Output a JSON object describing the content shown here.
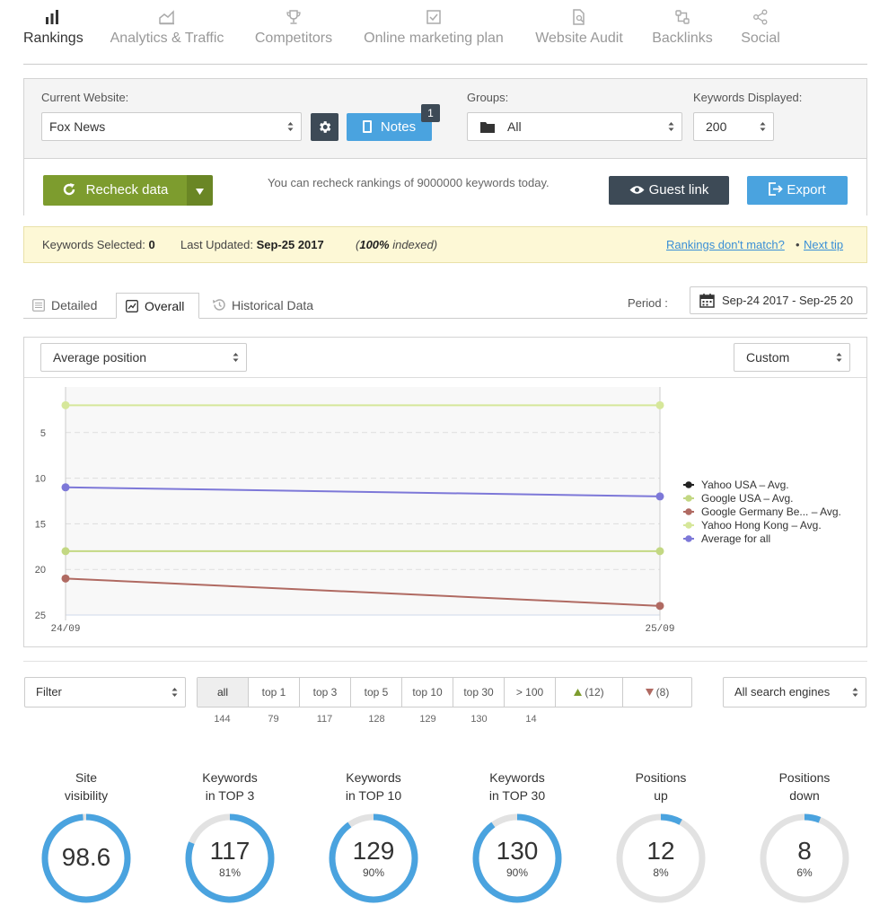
{
  "nav": [
    {
      "label": "Rankings",
      "icon": "bar-chart-icon",
      "active": true
    },
    {
      "label": "Analytics & Traffic",
      "icon": "area-chart-icon"
    },
    {
      "label": "Competitors",
      "icon": "trophy-icon"
    },
    {
      "label": "Online marketing plan",
      "icon": "checkbox-icon"
    },
    {
      "label": "Website Audit",
      "icon": "document-search-icon"
    },
    {
      "label": "Backlinks",
      "icon": "backlinks-icon"
    },
    {
      "label": "Social",
      "icon": "share-icon"
    }
  ],
  "settings": {
    "website_label": "Current Website:",
    "website_value": "Fox News",
    "notes_label": "Notes",
    "notes_badge": "1",
    "groups_label": "Groups:",
    "groups_value": "All",
    "keywords_label": "Keywords Displayed:",
    "keywords_value": "200",
    "recheck_label": "Recheck data",
    "recheck_info": "You can recheck rankings of 9000000 keywords today.",
    "guest_label": "Guest link",
    "export_label": "Export"
  },
  "tipbar": {
    "selected_label": "Keywords Selected:",
    "selected_value": "0",
    "updated_label": "Last Updated:",
    "updated_value": "Sep-25 2017",
    "indexed_pct": "100%",
    "indexed_text": " indexed)",
    "mismatch_link": "Rankings don't match?",
    "sep": "•",
    "next_tip": "Next tip"
  },
  "tabs": {
    "detailed": "Detailed",
    "overall": "Overall",
    "historical": "Historical Data",
    "period_label": "Period :",
    "period_value": "Sep-24 2017 - Sep-25 20"
  },
  "chart_controls": {
    "metric": "Average position",
    "range": "Custom"
  },
  "chart_data": {
    "type": "line",
    "x": [
      "24/09",
      "25/09"
    ],
    "y_reversed": true,
    "ylim": [
      0,
      25
    ],
    "yticks": [
      5,
      10,
      15,
      20,
      25
    ],
    "grid": true,
    "legend_position": "right",
    "series": [
      {
        "name": "Yahoo USA – Avg.",
        "color": "#222222",
        "values": [
          null,
          null
        ]
      },
      {
        "name": "Google USA – Avg.",
        "color": "#c3d883",
        "values": [
          18,
          18
        ]
      },
      {
        "name": "Google Germany Be... – Avg.",
        "color": "#b06a62",
        "values": [
          21,
          24
        ]
      },
      {
        "name": "Yahoo Hong Kong – Avg.",
        "color": "#d6e79a",
        "values": [
          2,
          2
        ]
      },
      {
        "name": "Average for all",
        "color": "#7d78d8",
        "values": [
          11,
          12
        ]
      }
    ]
  },
  "filters": {
    "filter_value": "Filter",
    "engines_value": "All search engines",
    "segments": [
      {
        "label": "all",
        "count": "144"
      },
      {
        "label": "top 1",
        "count": "79"
      },
      {
        "label": "top 3",
        "count": "117"
      },
      {
        "label": "top 5",
        "count": "128"
      },
      {
        "label": "top 10",
        "count": "129"
      },
      {
        "label": "top 30",
        "count": "130"
      },
      {
        "label": "> 100",
        "count": "14"
      },
      {
        "label": "(12)",
        "count": ""
      },
      {
        "label": "(8)",
        "count": ""
      }
    ]
  },
  "stats": [
    {
      "title1": "Site",
      "title2": "visibility",
      "value": "98.6",
      "pct": "",
      "fill": 0.986
    },
    {
      "title1": "Keywords",
      "title2": "in TOP 3",
      "value": "117",
      "pct": "81%",
      "fill": 0.81
    },
    {
      "title1": "Keywords",
      "title2": "in TOP 10",
      "value": "129",
      "pct": "90%",
      "fill": 0.9
    },
    {
      "title1": "Keywords",
      "title2": "in TOP 30",
      "value": "130",
      "pct": "90%",
      "fill": 0.9
    },
    {
      "title1": "Positions",
      "title2": "up",
      "value": "12",
      "pct": "8%",
      "fill": 0.08
    },
    {
      "title1": "Positions",
      "title2": "down",
      "value": "8",
      "pct": "6%",
      "fill": 0.06
    }
  ],
  "colors": {
    "green": "#7d9c2e",
    "blue": "#4aa3df",
    "dark": "#3d4a56",
    "ring": "#4aa3df",
    "ring_bg": "#e2e2e2"
  }
}
